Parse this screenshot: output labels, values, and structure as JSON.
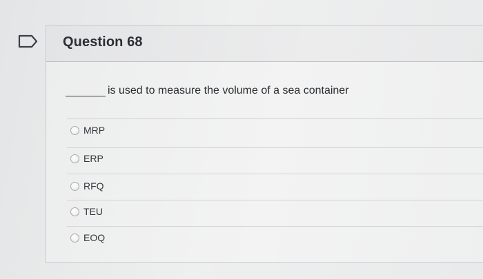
{
  "question": {
    "title": "Question 68",
    "blank": "______",
    "prompt": "is used to measure the volume of a sea container"
  },
  "options": [
    {
      "label": "MRP",
      "selected": false
    },
    {
      "label": "ERP",
      "selected": false
    },
    {
      "label": "RFQ",
      "selected": false
    },
    {
      "label": "TEU",
      "selected": false
    },
    {
      "label": "EOQ",
      "selected": false
    }
  ],
  "icons": {
    "flag": "flag-icon"
  },
  "colors": {
    "text": "#2c2f33",
    "divider": "#d0d2d4",
    "flag_stroke": "#3b3f44"
  }
}
